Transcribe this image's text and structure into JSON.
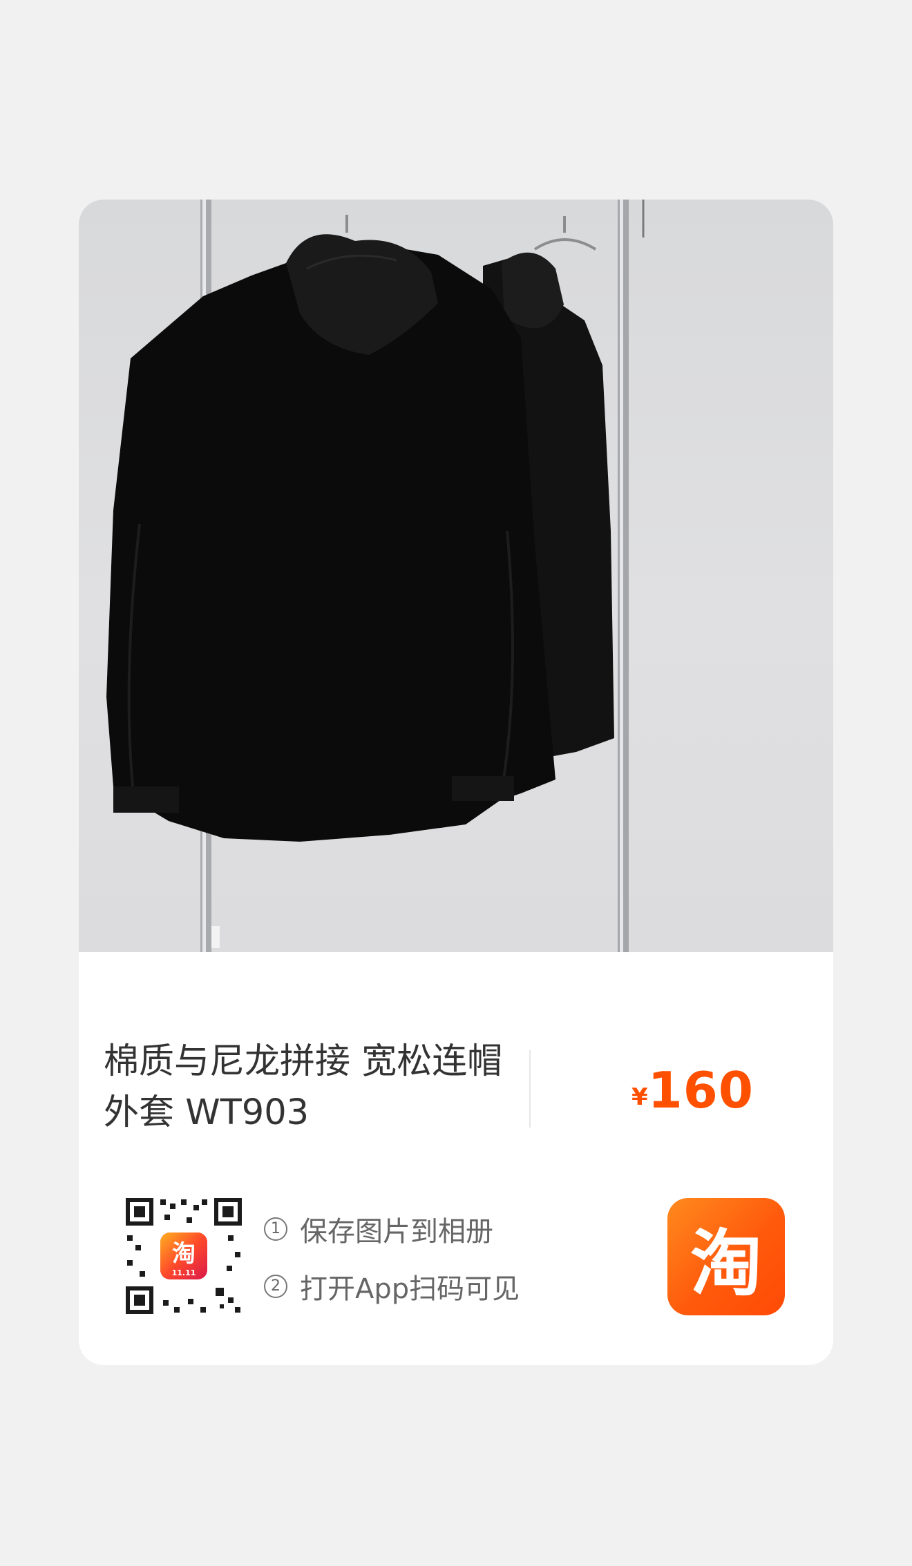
{
  "product": {
    "title_line1": "棉质与尼龙拼接 宽松连帽",
    "title_line2": "外套 WT903",
    "price_symbol": "¥",
    "price": "160"
  },
  "steps": [
    {
      "number": "1",
      "text": "保存图片到相册"
    },
    {
      "number": "2",
      "text": "打开App扫码可见"
    }
  ],
  "qr": {
    "badge_text": "淘",
    "badge_sub": "11.11"
  },
  "app": {
    "icon_glyph": "淘",
    "icon_name": "taobao-app-icon"
  },
  "colors": {
    "price": "#ff5000",
    "accent": "#ff6a10",
    "background": "#f1f1f1"
  }
}
